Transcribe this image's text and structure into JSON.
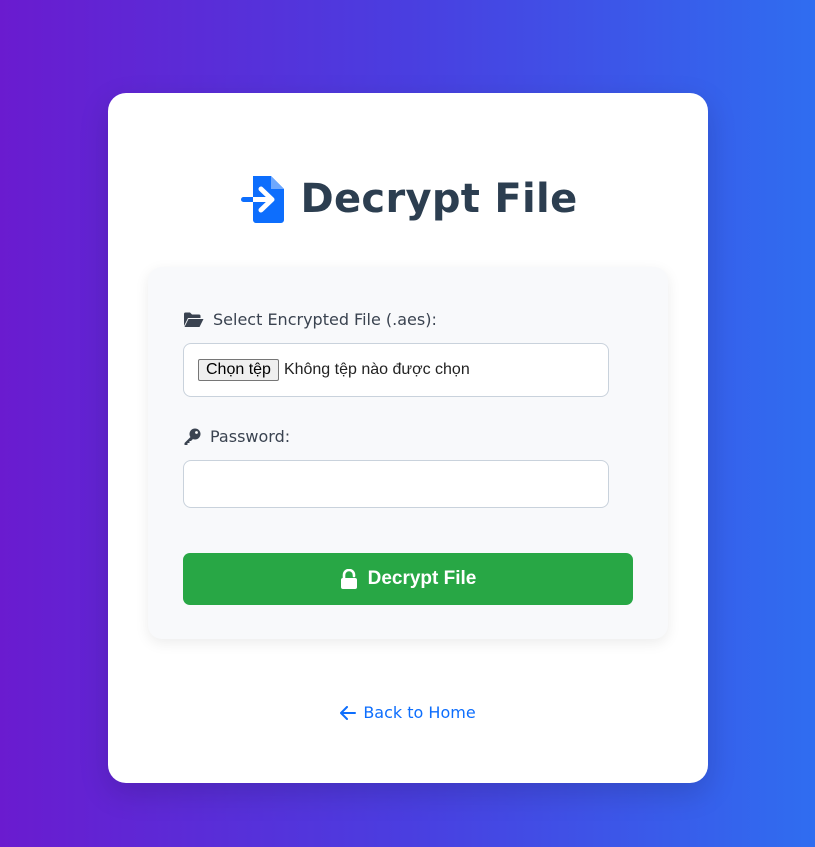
{
  "page": {
    "title": "Decrypt File",
    "title_icon": "file-import-icon"
  },
  "form": {
    "file_label": "Select Encrypted File (.aes):",
    "file_label_icon": "folder-open-icon",
    "file_button_label": "Chọn tệp",
    "file_status": "Không tệp nào được chọn",
    "password_label": "Password:",
    "password_label_icon": "key-icon",
    "password_value": "",
    "submit_label": "Decrypt File",
    "submit_icon": "unlock-icon"
  },
  "footer": {
    "back_label": "Back to Home",
    "back_icon": "arrow-left-icon"
  },
  "colors": {
    "background_gradient": [
      "#6a1bcf",
      "#2f6df0"
    ],
    "title": "#2c3e50",
    "accent_icon": "#0d6efd",
    "submit": "#28a745",
    "link": "#0d6efd"
  }
}
